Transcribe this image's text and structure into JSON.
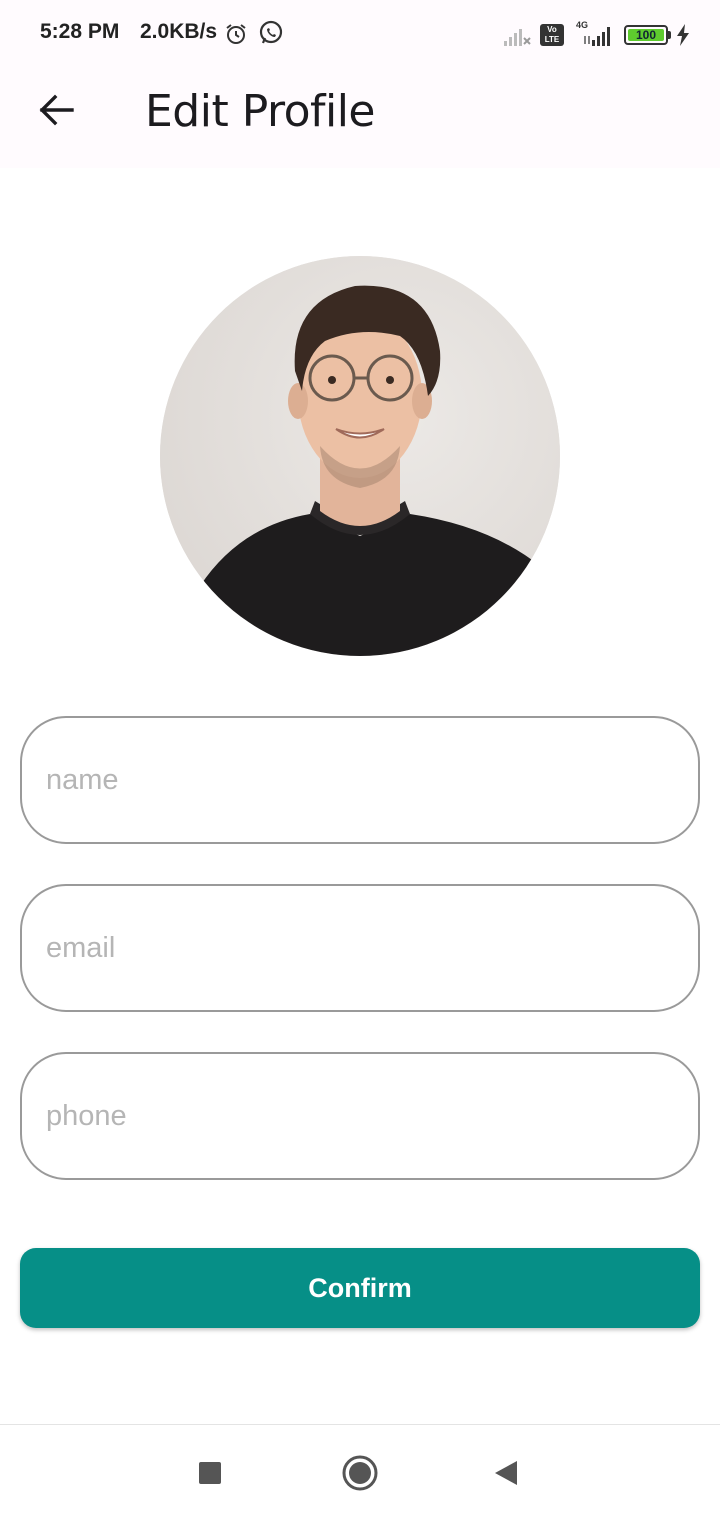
{
  "status_bar": {
    "time": "5:28 PM",
    "network_speed": "2.0KB/s",
    "alarm_icon": "alarm-icon",
    "whatsapp_icon": "whatsapp-icon",
    "volte_label": "Vo LTE",
    "network_type": "4G",
    "battery_level": "100",
    "battery_fill_color": "#5ecb2e",
    "charging_icon": "bolt-icon"
  },
  "app_bar": {
    "back_icon": "arrow-back-icon",
    "title": "Edit Profile",
    "background": "#fffbfe"
  },
  "profile": {
    "avatar_icon": "profile-photo"
  },
  "form": {
    "name": {
      "value": "",
      "placeholder": "name"
    },
    "email": {
      "value": "",
      "placeholder": "email"
    },
    "phone": {
      "value": "",
      "placeholder": "phone"
    },
    "confirm_label": "Confirm",
    "accent_color": "#068f87"
  },
  "nav_bar": {
    "recent_icon": "square-recent-icon",
    "home_icon": "circle-home-icon",
    "back_icon": "triangle-back-icon"
  }
}
